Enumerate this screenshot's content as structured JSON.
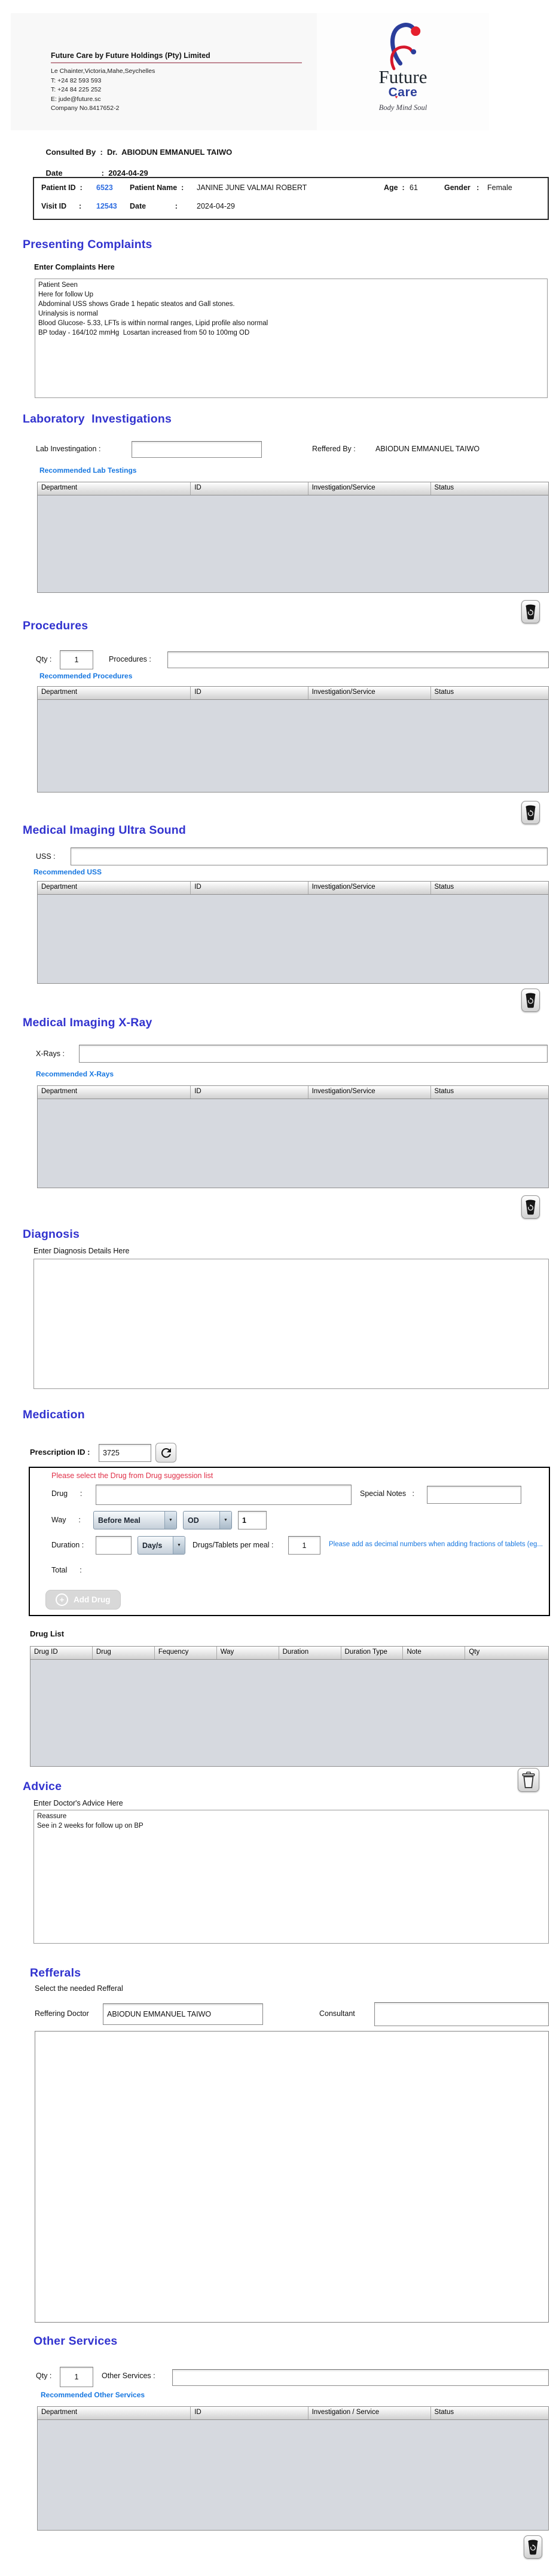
{
  "header": {
    "company_name": "Future Care by Future Holdings (Pty) Limited",
    "address": "Le Chainter,Victoria,Mahe,Seychelles",
    "phone_1": "T: +24  82 593 593",
    "phone_2": "T: +24  84 225 252",
    "email": "E: jude@future.sc",
    "company_no": "Company No.8417652-2",
    "logo": {
      "name": "Future",
      "sub": "Care",
      "tagline": "Body Mind Soul"
    }
  },
  "consult": {
    "consulted_by_label": "Consulted By  :  Dr.  ",
    "doctor_name": "ABIODUN EMMANUEL TAIWO",
    "date_label": "Date                  :  ",
    "date_value": "2024-04-29"
  },
  "patient": {
    "id_label": "Patient ID  :",
    "id": "6523",
    "name_label": "Patient Name  :",
    "name": "JANINE JUNE VALMAI ROBERT",
    "age_label": "Age  :",
    "age": "61",
    "gender_label": "Gender   :",
    "gender": "Female",
    "visit_id_label": "Visit ID      :",
    "visit_id": "12543",
    "visit_date_label": "Date              :",
    "visit_date": "2024-04-29"
  },
  "complaints": {
    "title": "Presenting Complaints",
    "label": "Enter Complaints Here",
    "text": "Patient Seen\nHere for follow Up\nAbdominal USS shows Grade 1 hepatic steatos and Gall stones.\nUrinalysis is normal\nBlood Glucose- 5.33, LFTs is within normal ranges, Lipid profile also normal\nBP today - 164/102 mmHg  Losartan increased from 50 to 100mg OD"
  },
  "lab": {
    "title": "Laboratory  Investigations",
    "input_label": "Lab Investingation :",
    "input_value": "",
    "referred_by_label": "Reffered By :",
    "referred_by": "ABIODUN EMMANUEL TAIWO",
    "link": "Recommended Lab Testings",
    "headers": [
      "Department",
      "ID",
      "Investigation/Service",
      "Status"
    ]
  },
  "procedures": {
    "title": "Procedures",
    "qty_label": "Qty :",
    "qty": "1",
    "input_label": "Procedures :",
    "input_value": "",
    "link": "Recommended Procedures",
    "headers": [
      "Department",
      "ID",
      "Investigation/Service",
      "Status"
    ]
  },
  "uss": {
    "title": "Medical Imaging Ultra Sound",
    "input_label": "USS :",
    "input_value": "",
    "link": "Recommended USS",
    "headers": [
      "Department",
      "ID",
      "Investigation/Service",
      "Status"
    ]
  },
  "xray": {
    "title": "Medical Imaging X-Ray",
    "input_label": "X-Rays :",
    "input_value": "",
    "link": "Recommended X-Rays",
    "headers": [
      "Department",
      "ID",
      "Investigation/Service",
      "Status"
    ]
  },
  "diagnosis": {
    "title": "Diagnosis",
    "label": "Enter Diagnosis Details Here",
    "text": ""
  },
  "medication": {
    "title": "Medication",
    "prescription_id_label": "Prescription ID :",
    "prescription_id": "3725",
    "suggestion_note": "Please select the Drug from Drug suggession list",
    "drug_label": "Drug      :",
    "drug_value": "",
    "special_notes_label": "Special Notes   :",
    "special_notes_value": "",
    "way_label": "Way      :",
    "meal_option": "Before Meal",
    "frequency_option": "OD",
    "frequency_qty": "1",
    "duration_label": "Duration :",
    "duration_value": "",
    "duration_unit": "Day/s",
    "per_meal_label": "Drugs/Tablets per meal :",
    "per_meal_value": "1",
    "fraction_note": "Please add as decimal numbers when adding fractions of tablets (eg...",
    "total_label": "Total      :",
    "add_drug_label": "Add Drug",
    "drug_list_label": "Drug List",
    "drug_headers": [
      "Drug ID",
      "Drug",
      "Fequency",
      "Way",
      "Duration",
      "Duration Type",
      "Note",
      "Qty"
    ]
  },
  "advice": {
    "title": "Advice",
    "label": "Enter Doctor's Advice Here",
    "text": "Reassure\nSee in 2 weeks for follow up on BP"
  },
  "referrals": {
    "title": "Refferals",
    "label": "Select the needed Refferal",
    "doctor_label": "Reffering Doctor",
    "doctor": "ABIODUN EMMANUEL TAIWO",
    "consultant_label": "Consultant",
    "consultant": ""
  },
  "other": {
    "title": "Other Services",
    "qty_label": "Qty :",
    "qty": "1",
    "input_label": "Other Services :",
    "input_value": "",
    "link": "Recommended Other Services",
    "headers": [
      "Department",
      "ID",
      "Investigation / Service",
      "Status"
    ]
  },
  "colors": {
    "heading": "#3233cf",
    "link": "#1777e0",
    "id_accent": "#2f6de0",
    "alert": "#e03048",
    "table_body": "#d6d9df"
  }
}
